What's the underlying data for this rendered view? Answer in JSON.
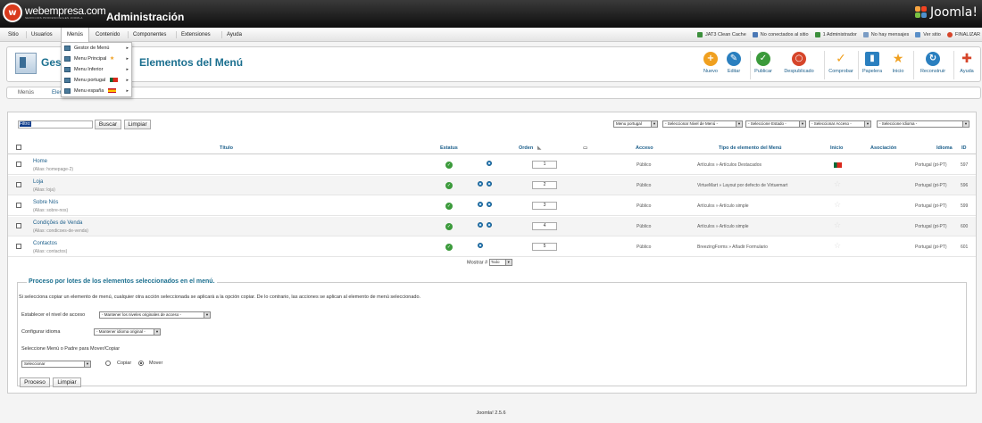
{
  "header": {
    "logo_initial": "w",
    "logo_name": "webempresa.com",
    "logo_tagline": "SERVICIOS PROFESIONALES JOOMLA",
    "title": "Administración",
    "brand": "Joomla!"
  },
  "menubar": {
    "items": [
      "Sitio",
      "Usuarios",
      "Menús",
      "Contenido",
      "Componentes",
      "Extensiones",
      "Ayuda"
    ],
    "status": [
      {
        "label": "JAT3 Clean Cache",
        "color": "#3c8f3c"
      },
      {
        "label": "No conectados al sitio",
        "color": "#4a78b5"
      },
      {
        "label": "1 Administrador",
        "color": "#3c8f3c"
      },
      {
        "label": "No hay mensajes",
        "color": "#7a9cc4"
      },
      {
        "label": "Ver sitio",
        "color": "#5a8fc8"
      },
      {
        "label": "FINALIZAR",
        "color": "#d6452a"
      }
    ]
  },
  "dropdown": {
    "items": [
      {
        "label": "Gestor de Menú"
      },
      {
        "label": "Menu Principal"
      },
      {
        "label": "Menu Inferior"
      },
      {
        "label": "Menu portugal"
      },
      {
        "label": "Menu españa"
      }
    ]
  },
  "toolbar": {
    "title_left": "Gest",
    "title_right": "Elementos del Menú",
    "buttons": [
      {
        "label": "Nuevo",
        "color": "#f0a020",
        "glyph": "+"
      },
      {
        "label": "Editar",
        "color": "#2a7fbf",
        "glyph": "✎"
      },
      {
        "label": "Publicar",
        "color": "#3b9a3b",
        "glyph": "✓"
      },
      {
        "label": "Despublicado",
        "color": "#d6452a",
        "glyph": "○"
      },
      {
        "label": "Comprobar",
        "color": "#f0a020",
        "glyph": "✓"
      },
      {
        "label": "Papelera",
        "color": "#2a7fbf",
        "glyph": "▮"
      },
      {
        "label": "Inicio",
        "color": "#f0a020",
        "glyph": "★"
      },
      {
        "label": "Reconstruir",
        "color": "#2a7fbf",
        "glyph": "↻"
      },
      {
        "label": "Ayuda",
        "color": "#d6452a",
        "glyph": "✚"
      }
    ]
  },
  "submenu": {
    "items": [
      "Menús",
      "Elementos"
    ]
  },
  "filter": {
    "label": "Filtro:",
    "search_button": "Buscar",
    "clear_button": "Limpiar",
    "selects": [
      "Menu portugal",
      "- Seleccionar Nivel de Menú -",
      "- Seleccione Estado -",
      "- Seleccionar Acceso -",
      "- Seleccione Idioma -"
    ]
  },
  "table": {
    "headers": {
      "title": "Título",
      "status": "Estatus",
      "order": "Orden",
      "access": "Acceso",
      "type": "Tipo de elemento del Menú",
      "home": "Inicio",
      "association": "Asociación",
      "language": "Idioma",
      "id": "ID"
    },
    "rows": [
      {
        "title": "Home",
        "alias": "(Alias: homepage-2)",
        "order": "1",
        "access": "Público",
        "type": "Artículos » Artículos Destacados",
        "home": "flag",
        "language": "Portugal (pt-PT)",
        "id": "597",
        "dots": 1
      },
      {
        "title": "Loja",
        "alias": "(Alias: loja)",
        "order": "2",
        "access": "Público",
        "type": "VirtueMart » Layout por defecto de Virtuemart",
        "home": "star",
        "language": "Portugal (pt-PT)",
        "id": "596",
        "dots": 2
      },
      {
        "title": "Sobre Nós",
        "alias": "(Alias: sobre-nos)",
        "order": "3",
        "access": "Público",
        "type": "Artículos » Artículo simple",
        "home": "star",
        "language": "Portugal (pt-PT)",
        "id": "599",
        "dots": 2
      },
      {
        "title": "Condições de Venda",
        "alias": "(Alias: condicoes-de-venda)",
        "order": "4",
        "access": "Público",
        "type": "Artículos » Artículo simple",
        "home": "star",
        "language": "Portugal (pt-PT)",
        "id": "600",
        "dots": 2
      },
      {
        "title": "Contactos",
        "alias": "(Alias: contactos)",
        "order": "5",
        "access": "Público",
        "type": "BreezingForms » Añadir Formulario",
        "home": "star",
        "language": "Portugal (pt-PT)",
        "id": "601",
        "dots": 1
      }
    ],
    "show_label": "Mostrar #",
    "show_value": "Todo"
  },
  "batch": {
    "legend": "Proceso por lotes de los elementos seleccionados en el menú.",
    "description": "Si selecciona copiar un elemento de menú, cualquier otra acción seleccionada se aplicará a la opción copiar. De lo contrario, las acciones se aplican al elemento de menú seleccionado.",
    "access_label": "Establecer el nivel de acceso",
    "access_select": "- Mantener los niveles originales de acceso -",
    "language_label": "Configurar idioma",
    "language_select": "- Mantener idioma original -",
    "move_label": "Seleccione Menú o Padre para Mover/Copiar",
    "move_select": "Seleccionar",
    "copy_label": "Copiar",
    "move_option": "Mover",
    "process_button": "Proceso",
    "clear_button": "Limpiar"
  },
  "footer": {
    "version": "Joomla! 2.5.6"
  }
}
